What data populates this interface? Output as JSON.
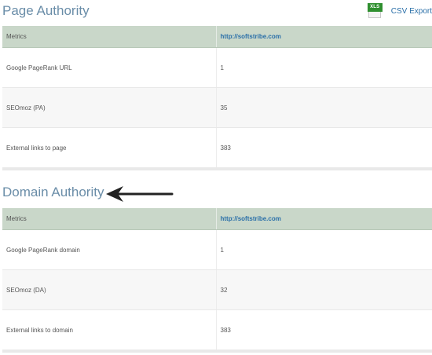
{
  "page_authority": {
    "title": "Page Authority",
    "export": {
      "icon_label": "XLS",
      "label": "CSV Export",
      "icon": "xls-file-icon"
    },
    "columns": [
      "Metrics",
      "http://softstribe.com"
    ],
    "rows": [
      {
        "metric": "Google PageRank URL",
        "value": "1"
      },
      {
        "metric": "SEOmoz (PA)",
        "value": "35"
      },
      {
        "metric": "External links to page",
        "value": "383"
      }
    ]
  },
  "domain_authority": {
    "title": "Domain Authority",
    "columns": [
      "Metrics",
      "http://softstribe.com"
    ],
    "rows": [
      {
        "metric": "Google PageRank domain",
        "value": "1"
      },
      {
        "metric": "SEOmoz (DA)",
        "value": "32"
      },
      {
        "metric": "External links to domain",
        "value": "383"
      }
    ]
  },
  "colors": {
    "title": "#6a8da8",
    "header_bg": "#c9d7c9",
    "link": "#2a6fa8",
    "xls_green": "#2f8f2f",
    "arrow": "#222222"
  }
}
